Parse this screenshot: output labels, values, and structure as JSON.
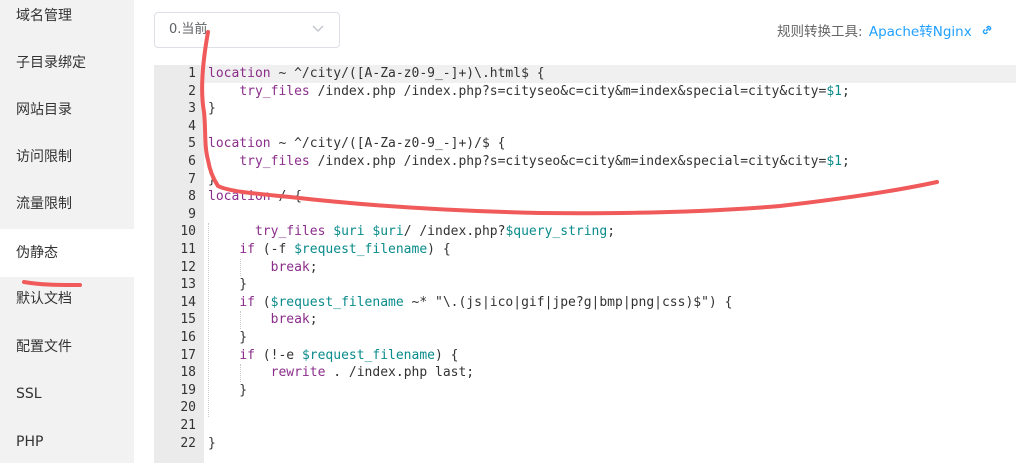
{
  "sidebar": {
    "items": [
      {
        "label": "域名管理"
      },
      {
        "label": "子目录绑定"
      },
      {
        "label": "网站目录"
      },
      {
        "label": "访问限制"
      },
      {
        "label": "流量限制"
      },
      {
        "label": "伪静态"
      },
      {
        "label": "默认文档"
      },
      {
        "label": "配置文件"
      },
      {
        "label": "SSL"
      },
      {
        "label": "PHP"
      }
    ],
    "active_index": 5
  },
  "template_select": {
    "value": "0.当前"
  },
  "rules_tool": {
    "label": "规则转换工具:",
    "link": "Apache转Nginx"
  },
  "editor": {
    "line_numbers": [
      "1",
      "2",
      "3",
      "4",
      "5",
      "6",
      "7",
      "8",
      "9",
      "10",
      "11",
      "12",
      "13",
      "14",
      "15",
      "16",
      "17",
      "18",
      "19",
      "20",
      "21",
      "22"
    ],
    "lines": [
      "location ~ ^/city/([A-Za-z0-9_-]+)\\.html$ {",
      "    try_files /index.php /index.php?s=cityseo&c=city&m=index&special=city&city=$1;",
      "}",
      "",
      "location ~ ^/city/([A-Za-z0-9_-]+)/$ {",
      "    try_files /index.php /index.php?s=cityseo&c=city&m=index&special=city&city=$1;",
      "}",
      "location / {",
      "",
      "      try_files $uri $uri/ /index.php?$query_string;",
      "    if (-f $request_filename) {",
      "        break;",
      "    }",
      "    if ($request_filename ~* \"\\.(js|ico|gif|jpe?g|bmp|png|css)$\") {",
      "        break;",
      "    }",
      "    if (!-e $request_filename) {",
      "        rewrite . /index.php last;",
      "    }",
      "",
      "",
      "}"
    ]
  },
  "colors": {
    "sidebar_bg": "#f2f2f2",
    "link": "#20a0ff",
    "keyword": "#8b2e8b",
    "variable": "#0a8b8b",
    "annotation": "#f05a5a"
  },
  "icons": [
    "chevron-down-icon",
    "link-icon"
  ]
}
